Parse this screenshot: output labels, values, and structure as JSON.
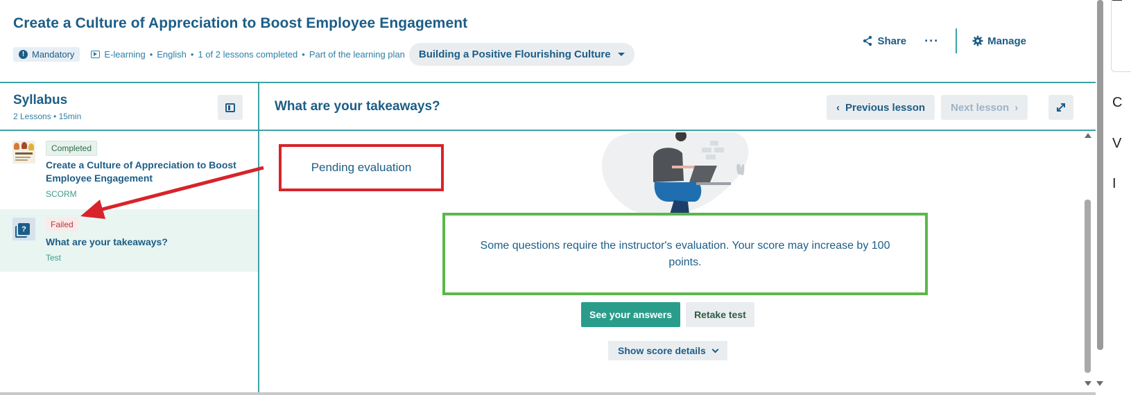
{
  "header": {
    "course_title": "Create a Culture of Appreciation to Boost Employee Engagement",
    "mandatory_label": "Mandatory",
    "meta": [
      "E-learning",
      "English",
      "1 of 2 lessons completed",
      "Part of the learning plan"
    ],
    "learning_plan": "Building a Positive Flourishing Culture",
    "share_label": "Share",
    "more_label": "···",
    "manage_label": "Manage"
  },
  "sidebar": {
    "title": "Syllabus",
    "summary": "2 Lessons •  15min",
    "lessons": [
      {
        "status": "Completed",
        "title": "Create a Culture of Appreciation to Boost Employee Engagement",
        "type": "SCORM"
      },
      {
        "status": "Failed",
        "title": "What are your takeaways?",
        "type": "Test"
      }
    ]
  },
  "main": {
    "lesson_title": "What are your takeaways?",
    "previous_label": "Previous lesson",
    "next_label": "Next lesson",
    "pending_label": "Pending evaluation",
    "notice": "Some questions require the instructor's evaluation. Your score may increase by 100 points.",
    "see_answers_label": "See your answers",
    "retake_label": "Retake test",
    "score_details_label": "Show score details"
  },
  "right_panel": {
    "letters": [
      "C",
      "V",
      "I"
    ]
  },
  "colors": {
    "brand": "#1c5d86",
    "accent_border": "#3ea0a6",
    "primary_button": "#2a9d8a",
    "failed": "#b4383b",
    "annotation_red": "#d8232a",
    "annotation_green": "#5bb84a"
  },
  "icons": {
    "share": "share-icon",
    "manage": "gear-icon",
    "collapse": "sidebar-collapse-icon",
    "expand": "expand-icon",
    "test": "test-icon"
  }
}
